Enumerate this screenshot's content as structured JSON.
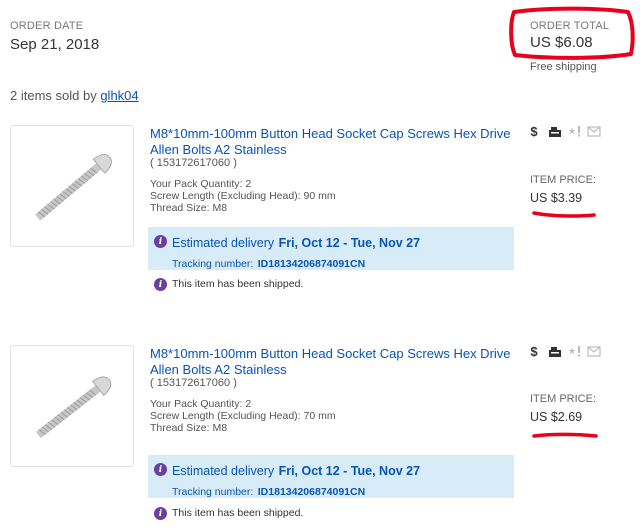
{
  "order": {
    "date_label": "ORDER DATE",
    "date_value": "Sep 21, 2018",
    "total_label": "ORDER TOTAL",
    "total_value": "US $6.08",
    "shipping_note": "Free shipping"
  },
  "sold": {
    "prefix": "2 items sold by",
    "seller": "glhk04"
  },
  "items": [
    {
      "title_line1": "M8*10mm-100mm Button Head Socket Cap Screws Hex Drive",
      "title_line2": "Allen Bolts A2 Stainless",
      "item_number": "( 153172617060 )",
      "spec1": "Your Pack Quantity: 2",
      "spec2": "Screw Length (Excluding Head): 90 mm",
      "spec3": "Thread Size: M8",
      "est_label": "Estimated delivery",
      "est_dates": "Fri, Oct 12 - Tue, Nov 27",
      "tracking_label": "Tracking number:",
      "tracking_number": "ID18134206874091CN",
      "shipped_status": "This item has been shipped.",
      "price_label": "ITEM PRICE:",
      "price_value": "US $3.39"
    },
    {
      "title_line1": "M8*10mm-100mm Button Head Socket Cap Screws Hex Drive",
      "title_line2": "Allen Bolts A2 Stainless",
      "item_number": "( 153172617060 )",
      "spec1": "Your Pack Quantity: 2",
      "spec2": "Screw Length (Excluding Head): 70 mm",
      "spec3": "Thread Size: M8",
      "est_label": "Estimated delivery",
      "est_dates": "Fri, Oct 12 - Tue, Nov 27",
      "tracking_label": "Tracking number:",
      "tracking_number": "ID18134206874091CN",
      "shipped_status": "This item has been shipped.",
      "price_label": "ITEM PRICE:",
      "price_value": "US $2.69"
    }
  ],
  "icons": {
    "dollar": "dollar-icon",
    "register": "cash-register-icon",
    "feedback": "star-exclamation-icon",
    "message": "envelope-icon"
  },
  "colors": {
    "link": "#0654ba",
    "annotation": "#e8001c",
    "delivery_bg": "#d8ecf7",
    "info_icon": "#6b3fa0"
  }
}
